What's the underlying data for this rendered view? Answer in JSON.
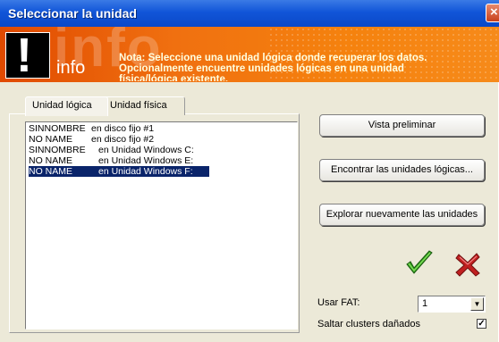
{
  "window": {
    "title": "Seleccionar la unidad"
  },
  "banner": {
    "watermark": "info",
    "label": "info",
    "note_line1": "Nota: Seleccione una unidad lógica donde recuperar los datos.",
    "note_line2": "Opcionalmente encuentre unidades lógicas en una unidad",
    "note_line3": "física/lógica existente."
  },
  "tabs": [
    {
      "label": "Unidad lógica"
    },
    {
      "label": "Unidad física"
    }
  ],
  "drives": [
    {
      "name": "SINNOMBRE",
      "location": "en disco fijo #1",
      "selected": false
    },
    {
      "name": "NO NAME",
      "location": "en disco fijo #2",
      "selected": false
    },
    {
      "name": "SINNOMBRE",
      "location": "en Unidad Windows C:",
      "selected": false
    },
    {
      "name": "NO NAME",
      "location": "en Unidad Windows E:",
      "selected": false
    },
    {
      "name": "NO NAME",
      "location": "en Unidad Windows F:",
      "selected": true
    }
  ],
  "buttons": {
    "preview": "Vista preliminar",
    "find": "Encontrar las unidades lógicas...",
    "rescan": "Explorar nuevamente las unidades"
  },
  "icons": {
    "ok": "checkmark-icon",
    "cancel": "cross-icon",
    "banner": "exclamation-icon"
  },
  "options": {
    "fat_label": "Usar FAT:",
    "fat_value": "1",
    "skip_label": "Saltar clusters dañados",
    "skip_checked": true
  },
  "colors": {
    "title_bar": "#0a48c8",
    "banner": "#f07010",
    "selection": "#0a246a",
    "ok": "#3aa020",
    "cancel": "#c02020"
  }
}
